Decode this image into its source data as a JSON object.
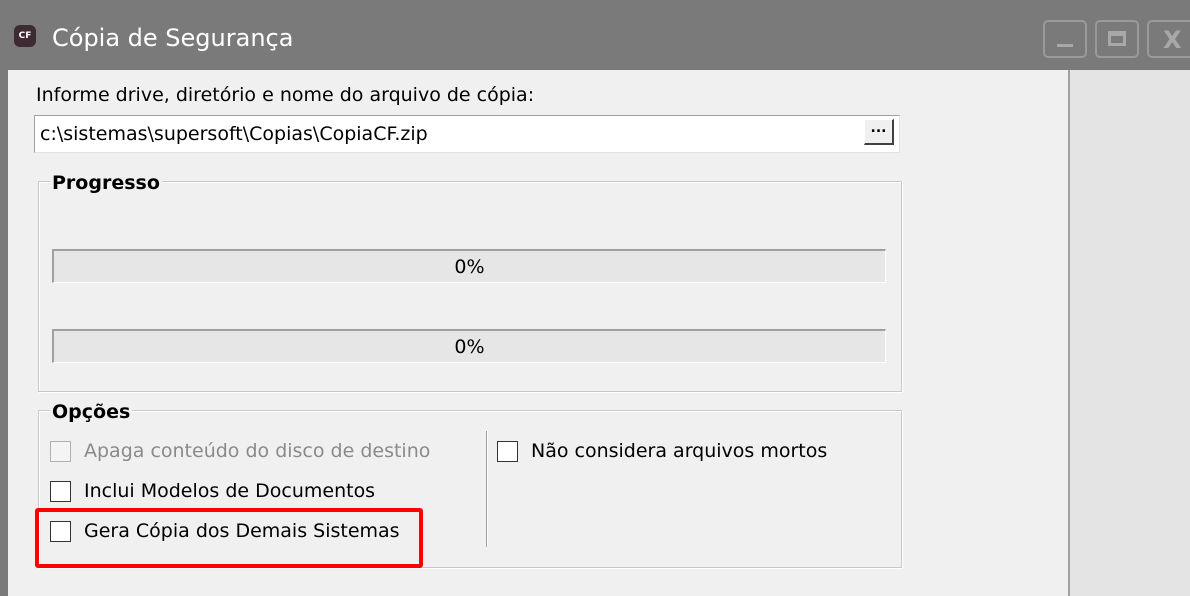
{
  "window": {
    "app_icon_text": "CF",
    "title": "Cópia de Segurança",
    "controls": {
      "minimize": "_",
      "maximize": "□",
      "close": "X"
    }
  },
  "file": {
    "label": "Informe drive, diretório e nome do arquivo de cópia:",
    "path_value": "c:\\sistemas\\supersoft\\Copias\\CopiaCF.zip",
    "browse_label": "..."
  },
  "progress": {
    "title": "Progresso",
    "bars": [
      {
        "value": 0,
        "label": "0%"
      },
      {
        "value": 0,
        "label": "0%"
      }
    ]
  },
  "options": {
    "title": "Opções",
    "left": [
      {
        "label": "Apaga conteúdo do disco de destino",
        "checked": false,
        "disabled": true
      },
      {
        "label": "Inclui Modelos de Documentos",
        "checked": false,
        "disabled": false
      },
      {
        "label": "Gera Cópia dos Demais Sistemas",
        "checked": false,
        "disabled": false,
        "highlighted": true
      }
    ],
    "right": [
      {
        "label": "Não considera arquivos mortos",
        "checked": false,
        "disabled": false
      }
    ]
  },
  "colors": {
    "titlebar": "#7a7a7a",
    "window_bg": "#f0f0f0",
    "highlight": "#ff0000"
  }
}
